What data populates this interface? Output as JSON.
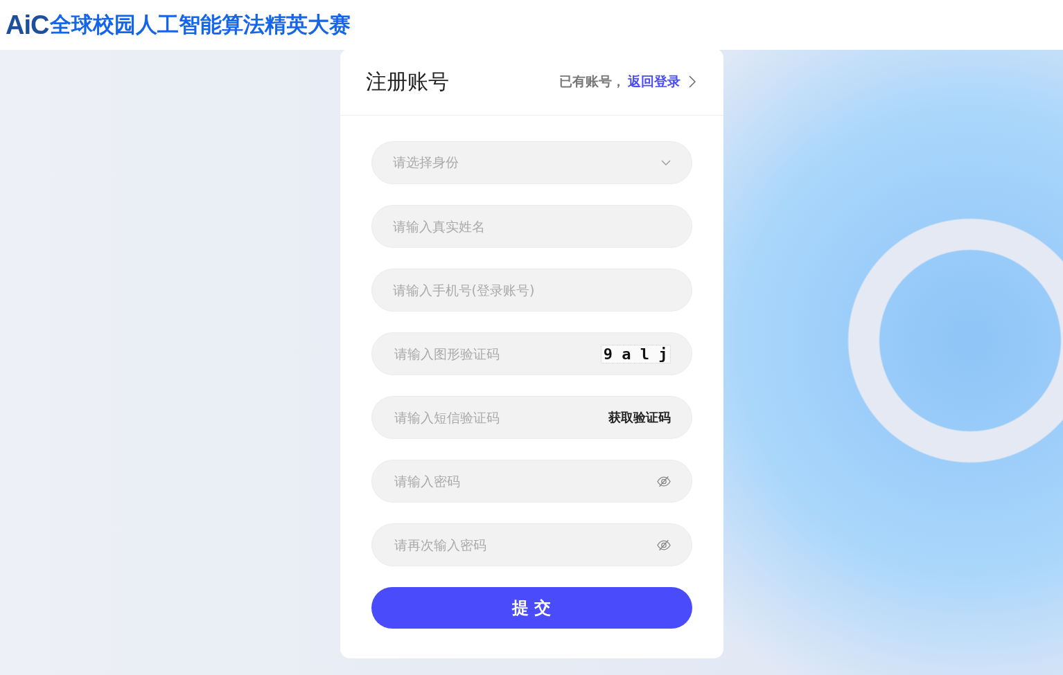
{
  "header": {
    "logo_mark": "AiC",
    "title": "全球校园人工智能算法精英大赛"
  },
  "card": {
    "title": "注册账号",
    "login_prompt": "已有账号，",
    "login_link": "返回登录"
  },
  "fields": [
    {
      "kind": "select",
      "placeholder": "请选择身份"
    },
    {
      "kind": "text",
      "placeholder": "请输入真实姓名"
    },
    {
      "kind": "text",
      "placeholder": "请输入手机号(登录账号)"
    },
    {
      "kind": "captcha",
      "placeholder": "请输入图形验证码",
      "captcha": "9 a l j"
    },
    {
      "kind": "sms",
      "placeholder": "请输入短信验证码",
      "action": "获取验证码"
    },
    {
      "kind": "password",
      "placeholder": "请输入密码"
    },
    {
      "kind": "password",
      "placeholder": "请再次输入密码"
    }
  ],
  "submit": "提 交"
}
